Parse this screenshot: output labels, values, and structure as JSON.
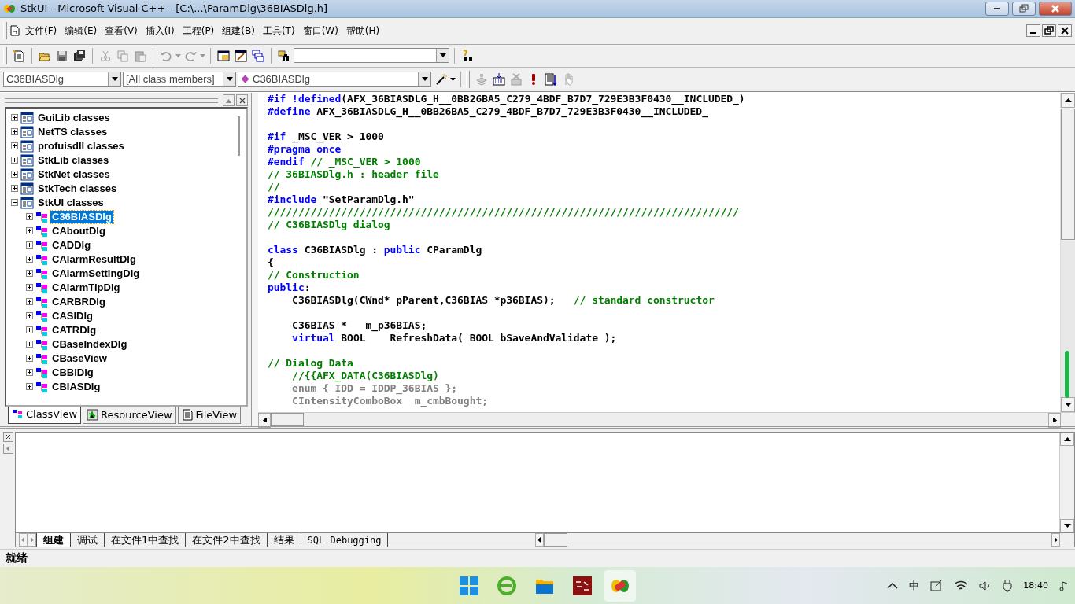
{
  "window": {
    "title": "StkUI - Microsoft Visual C++ - [C:\\...\\ParamDlg\\36BIASDlg.h]"
  },
  "menu": [
    "文件(F)",
    "编辑(E)",
    "查看(V)",
    "插入(I)",
    "工程(P)",
    "组建(B)",
    "工具(T)",
    "窗口(W)",
    "帮助(H)"
  ],
  "wizard_bar": {
    "class_combo": "C36BIASDlg",
    "filter_combo": "[All class members]",
    "member_combo": "C36BIASDlg"
  },
  "tree": [
    {
      "label": "GuiLib classes",
      "expanded": false,
      "selected": false
    },
    {
      "label": "NetTS classes",
      "expanded": false,
      "selected": false
    },
    {
      "label": "profuisdll classes",
      "expanded": false,
      "selected": false
    },
    {
      "label": "StkLib classes",
      "expanded": false,
      "selected": false
    },
    {
      "label": "StkNet classes",
      "expanded": false,
      "selected": false
    },
    {
      "label": "StkTech classes",
      "expanded": false,
      "selected": false
    },
    {
      "label": "StkUI classes",
      "expanded": true,
      "selected": false,
      "children": [
        {
          "label": "C36BIASDlg",
          "expanded": false,
          "selected": true
        },
        {
          "label": "CAboutDlg",
          "expanded": false,
          "selected": false
        },
        {
          "label": "CADDlg",
          "expanded": false,
          "selected": false
        },
        {
          "label": "CAlarmResultDlg",
          "expanded": false,
          "selected": false
        },
        {
          "label": "CAlarmSettingDlg",
          "expanded": false,
          "selected": false
        },
        {
          "label": "CAlarmTipDlg",
          "expanded": false,
          "selected": false
        },
        {
          "label": "CARBRDlg",
          "expanded": false,
          "selected": false
        },
        {
          "label": "CASIDlg",
          "expanded": false,
          "selected": false
        },
        {
          "label": "CATRDlg",
          "expanded": false,
          "selected": false
        },
        {
          "label": "CBaseIndexDlg",
          "expanded": false,
          "selected": false
        },
        {
          "label": "CBaseView",
          "expanded": false,
          "selected": false
        },
        {
          "label": "CBBIDlg",
          "expanded": false,
          "selected": false
        },
        {
          "label": "CBIASDlg",
          "expanded": false,
          "selected": false
        }
      ]
    }
  ],
  "workspace_tabs": [
    {
      "label": "ClassView",
      "kind": "class",
      "selected": true
    },
    {
      "label": "ResourceView",
      "kind": "resource",
      "selected": false
    },
    {
      "label": "FileView",
      "kind": "file",
      "selected": false
    }
  ],
  "code_lines": [
    {
      "kind": "code",
      "segments": [
        {
          "kind": "keyword",
          "text": "#if !defined"
        },
        {
          "kind": "plain",
          "text": "(AFX_36BIASDLG_H__0BB26BA5_C279_4BDF_B7D7_729E3B3F0430__INCLUDED_)"
        }
      ]
    },
    {
      "kind": "code",
      "segments": [
        {
          "kind": "keyword",
          "text": "#define"
        },
        {
          "kind": "plain",
          "text": " AFX_36BIASDLG_H__0BB26BA5_C279_4BDF_B7D7_729E3B3F0430__INCLUDED_"
        }
      ]
    },
    {
      "kind": "blank"
    },
    {
      "kind": "code",
      "segments": [
        {
          "kind": "keyword",
          "text": "#if"
        },
        {
          "kind": "plain",
          "text": " _MSC_VER > 1000"
        }
      ]
    },
    {
      "kind": "code",
      "segments": [
        {
          "kind": "keyword",
          "text": "#pragma once"
        }
      ]
    },
    {
      "kind": "code",
      "segments": [
        {
          "kind": "keyword",
          "text": "#endif"
        },
        {
          "kind": "comment",
          "text": " // _MSC_VER > 1000"
        }
      ]
    },
    {
      "kind": "code",
      "segments": [
        {
          "kind": "comment",
          "text": "// 36BIASDlg.h : header file"
        }
      ]
    },
    {
      "kind": "code",
      "segments": [
        {
          "kind": "comment",
          "text": "//"
        }
      ]
    },
    {
      "kind": "code",
      "segments": [
        {
          "kind": "keyword",
          "text": "#include"
        },
        {
          "kind": "plain",
          "text": " \"SetParamDlg.h\""
        }
      ]
    },
    {
      "kind": "code",
      "segments": [
        {
          "kind": "comment",
          "text": "/////////////////////////////////////////////////////////////////////////////"
        }
      ]
    },
    {
      "kind": "code",
      "segments": [
        {
          "kind": "comment",
          "text": "// C36BIASDlg dialog"
        }
      ]
    },
    {
      "kind": "blank"
    },
    {
      "kind": "code",
      "segments": [
        {
          "kind": "keyword",
          "text": "class"
        },
        {
          "kind": "plain",
          "text": " C36BIASDlg : "
        },
        {
          "kind": "keyword",
          "text": "public"
        },
        {
          "kind": "plain",
          "text": " CParamDlg"
        }
      ]
    },
    {
      "kind": "code",
      "segments": [
        {
          "kind": "plain",
          "text": "{"
        }
      ]
    },
    {
      "kind": "code",
      "segments": [
        {
          "kind": "comment",
          "text": "// Construction"
        }
      ]
    },
    {
      "kind": "code",
      "segments": [
        {
          "kind": "keyword",
          "text": "public"
        },
        {
          "kind": "plain",
          "text": ":"
        }
      ]
    },
    {
      "kind": "code",
      "segments": [
        {
          "kind": "plain",
          "text": "    C36BIASDlg(CWnd* pParent,C36BIAS *p36BIAS);   "
        },
        {
          "kind": "comment",
          "text": "// standard constructor"
        }
      ]
    },
    {
      "kind": "blank"
    },
    {
      "kind": "code",
      "segments": [
        {
          "kind": "plain",
          "text": "    C36BIAS *   m_p36BIAS;"
        }
      ]
    },
    {
      "kind": "code",
      "segments": [
        {
          "kind": "keyword",
          "text": "    virtual"
        },
        {
          "kind": "plain",
          "text": " BOOL    RefreshData( BOOL bSaveAndValidate );"
        }
      ]
    },
    {
      "kind": "blank"
    },
    {
      "kind": "code",
      "segments": [
        {
          "kind": "comment",
          "text": "// Dialog Data"
        }
      ]
    },
    {
      "kind": "code",
      "segments": [
        {
          "kind": "comment",
          "text": "    //{{AFX_DATA(C36BIASDlg)"
        }
      ]
    },
    {
      "kind": "code",
      "segments": [
        {
          "kind": "wizard",
          "text": "    enum { IDD = IDDP_36BIAS };"
        }
      ]
    },
    {
      "kind": "code",
      "segments": [
        {
          "kind": "wizard",
          "text": "    CIntensityComboBox  m_cmbBought;"
        }
      ]
    }
  ],
  "output_tabs": [
    {
      "label": "组建",
      "kind": "cjk",
      "selected": true
    },
    {
      "label": "调试",
      "kind": "cjk",
      "selected": false
    },
    {
      "label": "在文件1中查找",
      "kind": "cjk",
      "selected": false
    },
    {
      "label": "在文件2中查找",
      "kind": "cjk",
      "selected": false
    },
    {
      "label": "结果",
      "kind": "cjk",
      "selected": false
    },
    {
      "label": "SQL Debugging",
      "kind": "mono",
      "selected": false
    }
  ],
  "status_bar": {
    "text": "就绪"
  },
  "taskbar": {
    "tray": {
      "input_method": "中",
      "time": "18:40"
    }
  }
}
